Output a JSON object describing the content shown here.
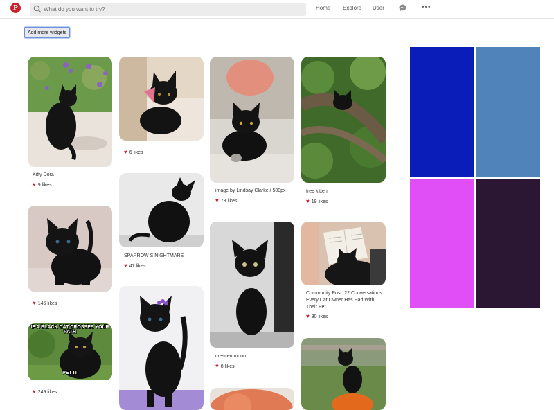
{
  "header": {
    "logo": "P",
    "search_placeholder": "What do you want to try?",
    "nav": [
      "Home",
      "Explore",
      "User"
    ],
    "more": "•••"
  },
  "toolbar": {
    "add_widgets_label": "Add more widgets"
  },
  "pins": [
    {
      "title": "Kitty Dora",
      "likes": "9 likes"
    },
    {
      "title": "",
      "likes": "145 likes"
    },
    {
      "title": "",
      "likes": "249 likes",
      "meme_top": "IF A BLACK CAT CROSSES YOUR PATH",
      "meme_bottom": "PET IT"
    },
    {
      "title": "",
      "likes": "6 likes"
    },
    {
      "title": "SPARROW S NIGHTMARE",
      "likes": "47 likes"
    },
    {
      "title": "",
      "likes": ""
    },
    {
      "title": "image by Lindsay Clarke / 500px",
      "likes": "73 likes"
    },
    {
      "title": "crescentmoon",
      "likes": "8 likes"
    },
    {
      "title": "",
      "likes": ""
    },
    {
      "title": "tree kitten",
      "likes": "19 likes"
    },
    {
      "title": "Community Post: 22 Conversations Every Cat Owner Has Had With Their Pet",
      "likes": "30 likes"
    },
    {
      "title": "",
      "likes": ""
    }
  ],
  "palette": {
    "colors": [
      "#0b1db8",
      "#4f83ba",
      "#e04ef5",
      "#2b1633"
    ]
  },
  "colors": {
    "accent": "#cb2027",
    "heart": "#c8232c"
  }
}
